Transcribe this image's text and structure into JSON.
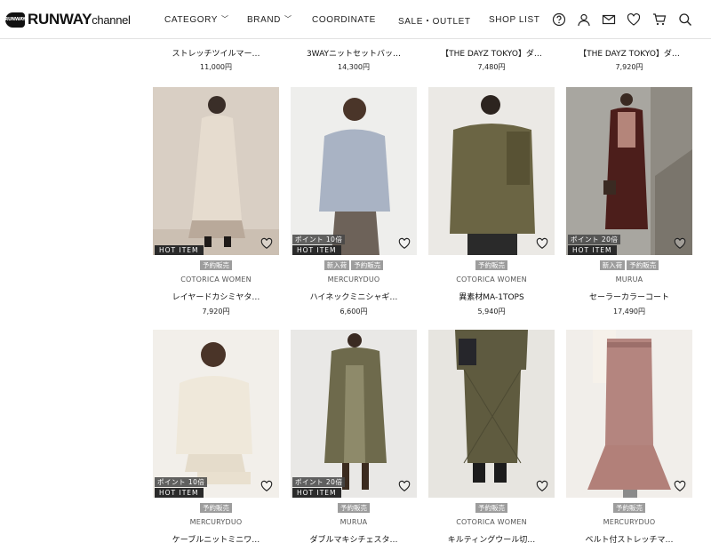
{
  "header": {
    "logo_mark": "RUNWAY",
    "logo_main": "RUNWAY",
    "logo_sub": "channel",
    "nav": [
      {
        "label": "CATEGORY",
        "dropdown": true
      },
      {
        "label": "BRAND",
        "dropdown": true
      },
      {
        "label": "COORDINATE",
        "dropdown": false
      },
      {
        "label": "SALE・OUTLET",
        "dropdown": false
      },
      {
        "label": "SHOP LIST",
        "dropdown": false
      }
    ],
    "icons": [
      "help-icon",
      "user-icon",
      "mail-icon",
      "heart-icon",
      "cart-icon",
      "search-icon"
    ]
  },
  "products_top_row": [
    {
      "name": "ストレッチツイルマー…",
      "price": "11,000円"
    },
    {
      "name": "3WAYニットセットバッ…",
      "price": "14,300円"
    },
    {
      "name": "【THE DAYZ TOKYO】ダ…",
      "price": "7,480円"
    },
    {
      "name": "【THE DAYZ TOKYO】ダ…",
      "price": "7,920円"
    }
  ],
  "products_row2": [
    {
      "point": "",
      "hot": "HOT ITEM",
      "tags": [
        "予約販売"
      ],
      "brand": "COTORICA WOMEN",
      "name": "レイヤードカシミヤタ…",
      "price": "7,920円"
    },
    {
      "point": "ポイント 10倍",
      "hot": "HOT ITEM",
      "tags": [
        "新入荷",
        "予約販売"
      ],
      "brand": "MERCURYDUO",
      "name": "ハイネックミニシャギ…",
      "price": "6,600円"
    },
    {
      "point": "",
      "hot": "",
      "tags": [
        "予約販売"
      ],
      "brand": "COTORICA WOMEN",
      "name": "異素材MA-1TOPS",
      "price": "5,940円"
    },
    {
      "point": "ポイント 20倍",
      "hot": "HOT ITEM",
      "tags": [
        "新入荷",
        "予約販売"
      ],
      "brand": "MURUA",
      "name": "セーラーカラーコート",
      "price": "17,490円"
    }
  ],
  "products_row3": [
    {
      "point": "ポイント 10倍",
      "hot": "HOT ITEM",
      "tags": [
        "予約販売"
      ],
      "brand": "MERCURYDUO",
      "name": "ケーブルニットミニワ…"
    },
    {
      "point": "ポイント 20倍",
      "hot": "HOT ITEM",
      "tags": [
        "予約販売"
      ],
      "brand": "MURUA",
      "name": "ダブルマキシチェスタ…"
    },
    {
      "point": "",
      "hot": "",
      "tags": [
        "予約販売"
      ],
      "brand": "COTORICA WOMEN",
      "name": "キルティングウール切…"
    },
    {
      "point": "",
      "hot": "",
      "tags": [
        "予約販売"
      ],
      "brand": "MERCURYDUO",
      "name": "ベルト付ストレッチマ…"
    }
  ],
  "colors": {
    "tag_bg": "#9d9d9d",
    "hot_bg": "#2a2a2a",
    "point_bg": "#464646"
  }
}
